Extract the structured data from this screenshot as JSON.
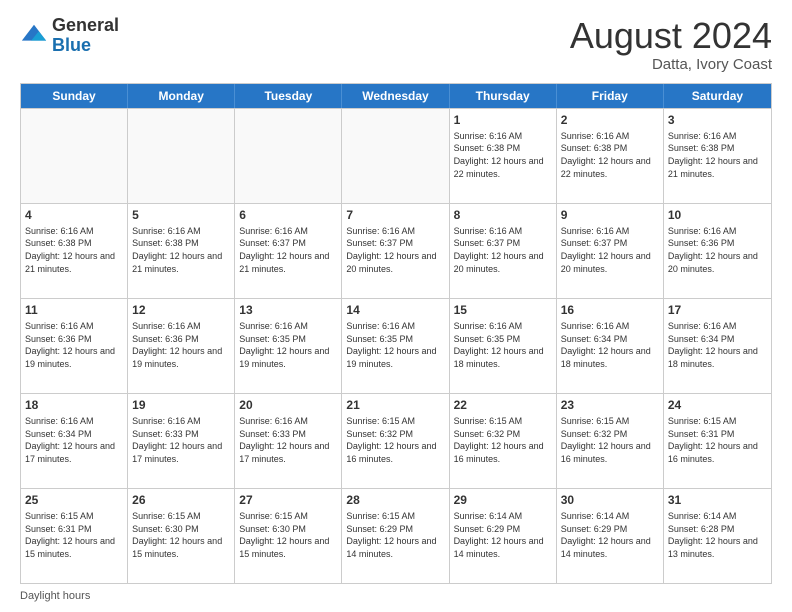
{
  "header": {
    "logo_general": "General",
    "logo_blue": "Blue",
    "month_title": "August 2024",
    "subtitle": "Datta, Ivory Coast"
  },
  "calendar": {
    "days_of_week": [
      "Sunday",
      "Monday",
      "Tuesday",
      "Wednesday",
      "Thursday",
      "Friday",
      "Saturday"
    ],
    "weeks": [
      [
        {
          "day": "",
          "empty": true
        },
        {
          "day": "",
          "empty": true
        },
        {
          "day": "",
          "empty": true
        },
        {
          "day": "",
          "empty": true
        },
        {
          "day": "1",
          "sunrise": "6:16 AM",
          "sunset": "6:38 PM",
          "daylight": "12 hours and 22 minutes."
        },
        {
          "day": "2",
          "sunrise": "6:16 AM",
          "sunset": "6:38 PM",
          "daylight": "12 hours and 22 minutes."
        },
        {
          "day": "3",
          "sunrise": "6:16 AM",
          "sunset": "6:38 PM",
          "daylight": "12 hours and 21 minutes."
        }
      ],
      [
        {
          "day": "4",
          "sunrise": "6:16 AM",
          "sunset": "6:38 PM",
          "daylight": "12 hours and 21 minutes."
        },
        {
          "day": "5",
          "sunrise": "6:16 AM",
          "sunset": "6:38 PM",
          "daylight": "12 hours and 21 minutes."
        },
        {
          "day": "6",
          "sunrise": "6:16 AM",
          "sunset": "6:37 PM",
          "daylight": "12 hours and 21 minutes."
        },
        {
          "day": "7",
          "sunrise": "6:16 AM",
          "sunset": "6:37 PM",
          "daylight": "12 hours and 20 minutes."
        },
        {
          "day": "8",
          "sunrise": "6:16 AM",
          "sunset": "6:37 PM",
          "daylight": "12 hours and 20 minutes."
        },
        {
          "day": "9",
          "sunrise": "6:16 AM",
          "sunset": "6:37 PM",
          "daylight": "12 hours and 20 minutes."
        },
        {
          "day": "10",
          "sunrise": "6:16 AM",
          "sunset": "6:36 PM",
          "daylight": "12 hours and 20 minutes."
        }
      ],
      [
        {
          "day": "11",
          "sunrise": "6:16 AM",
          "sunset": "6:36 PM",
          "daylight": "12 hours and 19 minutes."
        },
        {
          "day": "12",
          "sunrise": "6:16 AM",
          "sunset": "6:36 PM",
          "daylight": "12 hours and 19 minutes."
        },
        {
          "day": "13",
          "sunrise": "6:16 AM",
          "sunset": "6:35 PM",
          "daylight": "12 hours and 19 minutes."
        },
        {
          "day": "14",
          "sunrise": "6:16 AM",
          "sunset": "6:35 PM",
          "daylight": "12 hours and 19 minutes."
        },
        {
          "day": "15",
          "sunrise": "6:16 AM",
          "sunset": "6:35 PM",
          "daylight": "12 hours and 18 minutes."
        },
        {
          "day": "16",
          "sunrise": "6:16 AM",
          "sunset": "6:34 PM",
          "daylight": "12 hours and 18 minutes."
        },
        {
          "day": "17",
          "sunrise": "6:16 AM",
          "sunset": "6:34 PM",
          "daylight": "12 hours and 18 minutes."
        }
      ],
      [
        {
          "day": "18",
          "sunrise": "6:16 AM",
          "sunset": "6:34 PM",
          "daylight": "12 hours and 17 minutes."
        },
        {
          "day": "19",
          "sunrise": "6:16 AM",
          "sunset": "6:33 PM",
          "daylight": "12 hours and 17 minutes."
        },
        {
          "day": "20",
          "sunrise": "6:16 AM",
          "sunset": "6:33 PM",
          "daylight": "12 hours and 17 minutes."
        },
        {
          "day": "21",
          "sunrise": "6:15 AM",
          "sunset": "6:32 PM",
          "daylight": "12 hours and 16 minutes."
        },
        {
          "day": "22",
          "sunrise": "6:15 AM",
          "sunset": "6:32 PM",
          "daylight": "12 hours and 16 minutes."
        },
        {
          "day": "23",
          "sunrise": "6:15 AM",
          "sunset": "6:32 PM",
          "daylight": "12 hours and 16 minutes."
        },
        {
          "day": "24",
          "sunrise": "6:15 AM",
          "sunset": "6:31 PM",
          "daylight": "12 hours and 16 minutes."
        }
      ],
      [
        {
          "day": "25",
          "sunrise": "6:15 AM",
          "sunset": "6:31 PM",
          "daylight": "12 hours and 15 minutes."
        },
        {
          "day": "26",
          "sunrise": "6:15 AM",
          "sunset": "6:30 PM",
          "daylight": "12 hours and 15 minutes."
        },
        {
          "day": "27",
          "sunrise": "6:15 AM",
          "sunset": "6:30 PM",
          "daylight": "12 hours and 15 minutes."
        },
        {
          "day": "28",
          "sunrise": "6:15 AM",
          "sunset": "6:29 PM",
          "daylight": "12 hours and 14 minutes."
        },
        {
          "day": "29",
          "sunrise": "6:14 AM",
          "sunset": "6:29 PM",
          "daylight": "12 hours and 14 minutes."
        },
        {
          "day": "30",
          "sunrise": "6:14 AM",
          "sunset": "6:29 PM",
          "daylight": "12 hours and 14 minutes."
        },
        {
          "day": "31",
          "sunrise": "6:14 AM",
          "sunset": "6:28 PM",
          "daylight": "12 hours and 13 minutes."
        }
      ]
    ]
  },
  "footer": {
    "note": "Daylight hours"
  }
}
